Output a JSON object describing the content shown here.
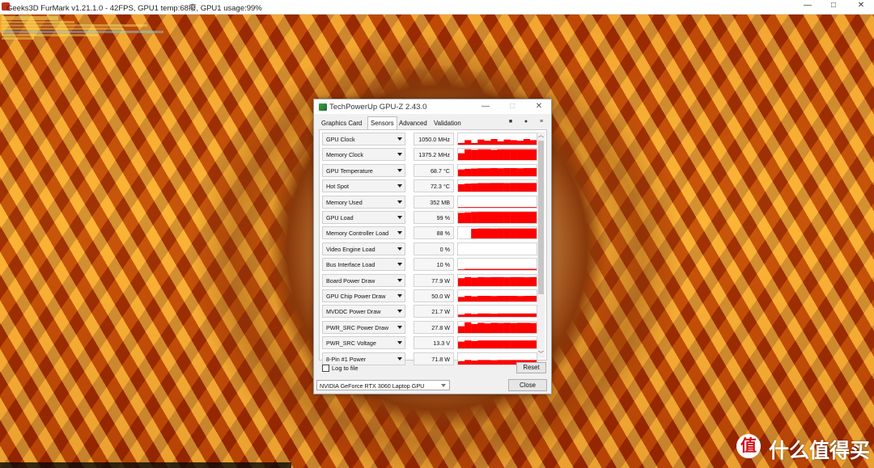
{
  "furmark": {
    "title": "Geeks3D FurMark v1.21.1.0 - 42FPS, GPU1 temp:68癈, GPU1 usage:99%",
    "window_controls": {
      "minimize": "—",
      "maximize": "□",
      "close": "✕"
    }
  },
  "watermark": {
    "badge": "值",
    "text": "什么值得买"
  },
  "gpuz": {
    "title": "TechPowerUp GPU-Z 2.43.0",
    "window_controls": {
      "minimize": "—",
      "maximize": "□",
      "close": "✕"
    },
    "tabs": [
      "Graphics Card",
      "Sensors",
      "Advanced",
      "Validation"
    ],
    "active_tab": "Sensors",
    "toolbar_icons": [
      "camera-icon",
      "refresh-icon",
      "menu-icon"
    ],
    "sensors": [
      {
        "name": "GPU Clock",
        "value": "1050.0 MHz",
        "history": [
          0.15,
          0.4,
          0.15,
          0.45,
          0.35,
          0.5,
          0.3,
          0.45,
          0.4,
          0.35,
          0.5,
          0.4
        ]
      },
      {
        "name": "Memory Clock",
        "value": "1375.2 MHz",
        "history": [
          0.6,
          0.95,
          0.9,
          0.95,
          0.95,
          0.9,
          0.95,
          0.95,
          0.95,
          0.95,
          0.95,
          0.95
        ]
      },
      {
        "name": "GPU Temperature",
        "value": "68.7 °C",
        "history": [
          0.6,
          0.65,
          0.68,
          0.7,
          0.7,
          0.72,
          0.7,
          0.72,
          0.72,
          0.7,
          0.72,
          0.72
        ]
      },
      {
        "name": "Hot Spot",
        "value": "72.3 °C",
        "history": [
          0.65,
          0.7,
          0.72,
          0.75,
          0.75,
          0.76,
          0.76,
          0.75,
          0.76,
          0.76,
          0.76,
          0.76
        ]
      },
      {
        "name": "Memory Used",
        "value": "352 MB",
        "history": [
          0.05,
          0.06,
          0.06,
          0.06,
          0.06,
          0.06,
          0.06,
          0.06,
          0.06,
          0.06,
          0.06,
          0.06
        ]
      },
      {
        "name": "GPU Load",
        "value": "99 %",
        "history": [
          0.9,
          0.95,
          0.98,
          0.99,
          0.99,
          0.99,
          0.99,
          0.99,
          0.99,
          0.99,
          0.99,
          0.99
        ]
      },
      {
        "name": "Memory Controller Load",
        "value": "88 %",
        "history": [
          0.0,
          0.0,
          0.85,
          0.88,
          0.88,
          0.87,
          0.88,
          0.88,
          0.88,
          0.88,
          0.88,
          0.88
        ]
      },
      {
        "name": "Video Engine Load",
        "value": "0 %",
        "history": [
          0,
          0,
          0,
          0,
          0,
          0,
          0,
          0,
          0,
          0,
          0,
          0
        ]
      },
      {
        "name": "Bus Interface Load",
        "value": "10 %",
        "history": [
          0.05,
          0.1,
          0.1,
          0.1,
          0.1,
          0.1,
          0.1,
          0.1,
          0.1,
          0.1,
          0.1,
          0.1
        ]
      },
      {
        "name": "Board Power Draw",
        "value": "77.9 W",
        "history": [
          0.7,
          0.8,
          0.75,
          0.8,
          0.78,
          0.8,
          0.8,
          0.78,
          0.8,
          0.8,
          0.78,
          0.8
        ]
      },
      {
        "name": "GPU Chip Power Draw",
        "value": "50.0 W",
        "history": [
          0.4,
          0.5,
          0.45,
          0.5,
          0.5,
          0.48,
          0.5,
          0.5,
          0.5,
          0.48,
          0.5,
          0.5
        ]
      },
      {
        "name": "MVDDC Power Draw",
        "value": "21.7 W",
        "history": [
          0.2,
          0.3,
          0.25,
          0.3,
          0.3,
          0.28,
          0.3,
          0.3,
          0.3,
          0.3,
          0.3,
          0.3
        ]
      },
      {
        "name": "PWR_SRC Power Draw",
        "value": "27.8 W",
        "history": [
          0.6,
          0.95,
          0.8,
          0.9,
          0.85,
          0.9,
          0.88,
          0.9,
          0.88,
          0.9,
          0.9,
          0.88
        ]
      },
      {
        "name": "PWR_SRC Voltage",
        "value": "13.3 V",
        "history": [
          0.6,
          0.7,
          0.65,
          0.7,
          0.7,
          0.7,
          0.7,
          0.7,
          0.7,
          0.7,
          0.7,
          0.7
        ]
      },
      {
        "name": "8-Pin #1 Power",
        "value": "71.8 W",
        "history": [
          0.3,
          0.4,
          0.35,
          0.4,
          0.4,
          0.38,
          0.4,
          0.4,
          0.4,
          0.4,
          0.4,
          0.4
        ]
      }
    ],
    "graph_color": "#ff0000",
    "log_to_file_label": "Log to file",
    "log_to_file_checked": false,
    "reset_label": "Reset",
    "gpu_select": "NVIDIA GeForce RTX 3060 Laptop GPU",
    "close_label": "Close"
  }
}
